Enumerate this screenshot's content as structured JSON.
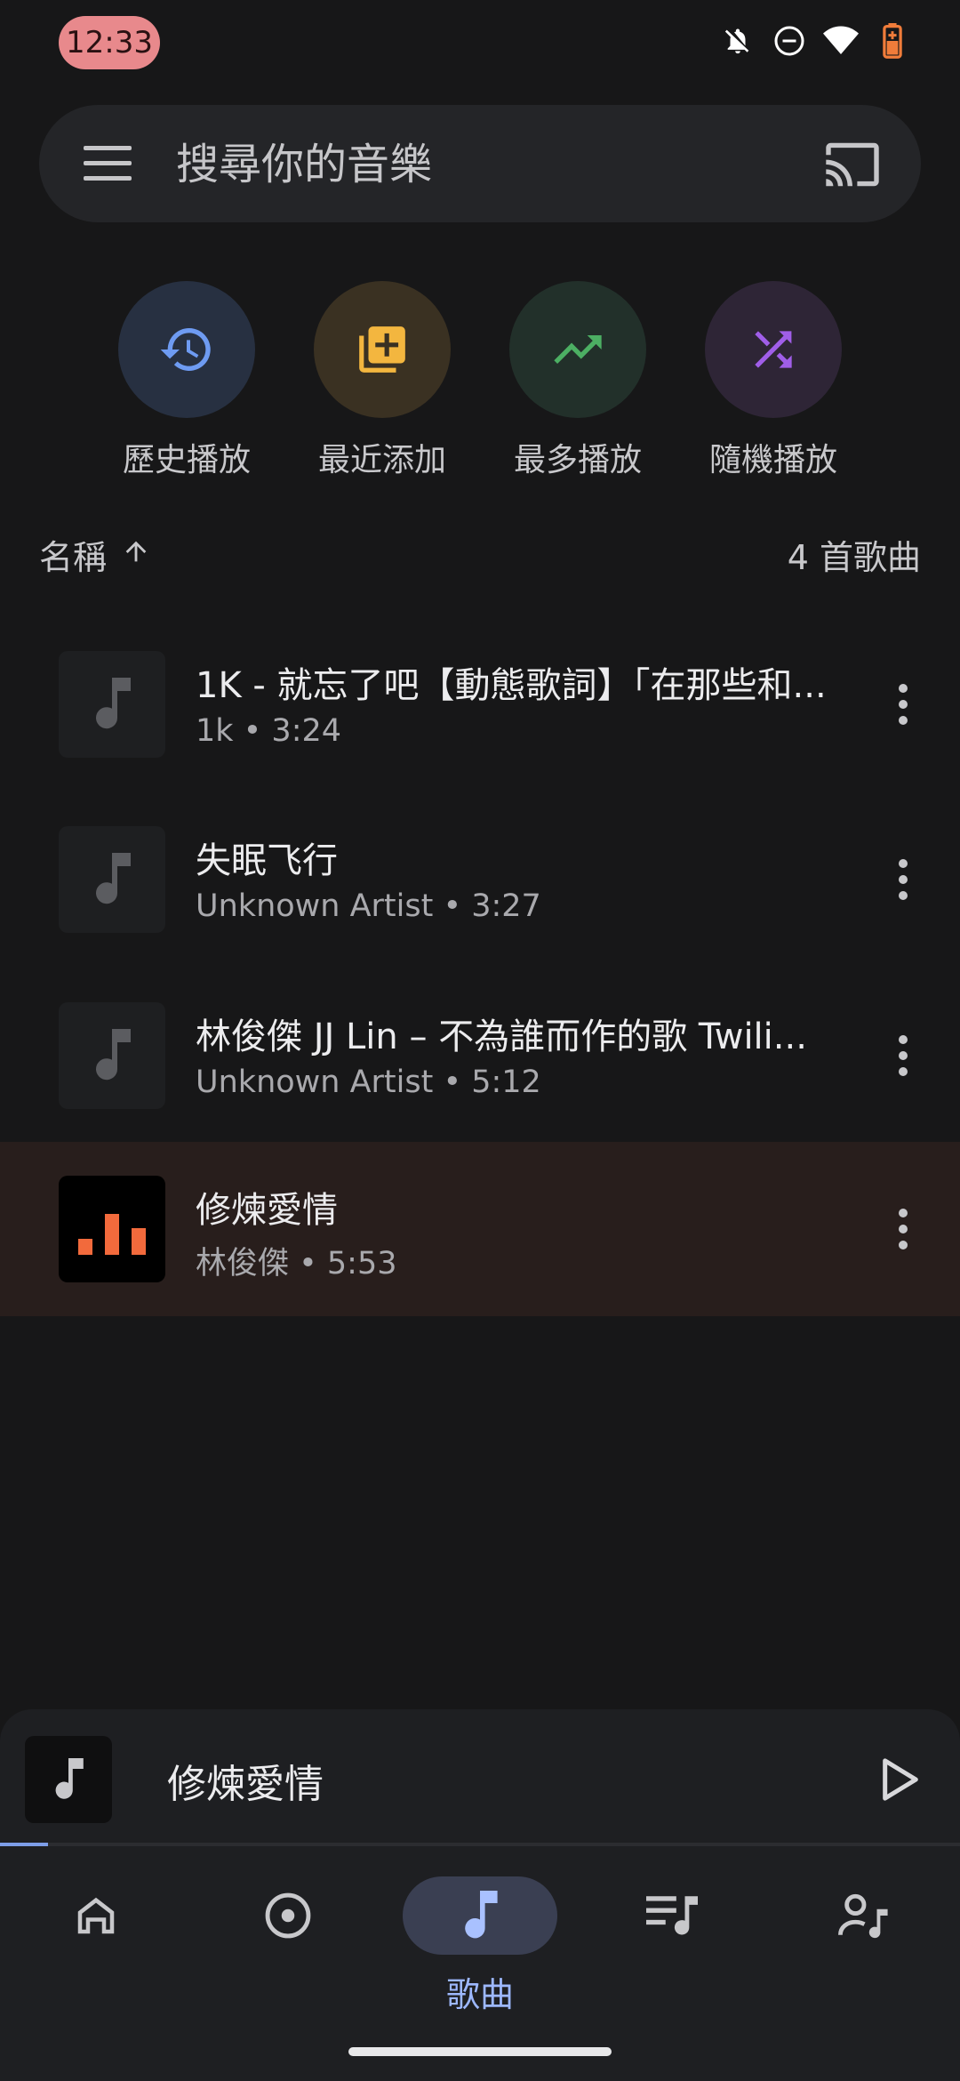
{
  "status_bar": {
    "time": "12:33",
    "icons": [
      "bell-off-icon",
      "do-not-disturb-icon",
      "wifi-icon",
      "battery-charging-icon"
    ]
  },
  "search": {
    "placeholder": "搜尋你的音樂",
    "value": ""
  },
  "quick_actions": [
    {
      "label": "歷史播放",
      "icon": "history-icon",
      "bg": "#273041",
      "fg": "#6e9bf2"
    },
    {
      "label": "最近添加",
      "icon": "add-library-icon",
      "bg": "#3a3122",
      "fg": "#f3b63f"
    },
    {
      "label": "最多播放",
      "icon": "trending-up-icon",
      "bg": "#22302a",
      "fg": "#4caf63"
    },
    {
      "label": "隨機播放",
      "icon": "shuffle-icon",
      "bg": "#2e2536",
      "fg": "#a05ee8"
    }
  ],
  "list_header": {
    "sort_label": "名稱",
    "sort_icon": "arrow-up-icon",
    "count": "4 首歌曲"
  },
  "songs": [
    {
      "title": "1K - 就忘了吧【動態歌詞】「在那些和...",
      "subtitle": "1k • 3:24",
      "active": false
    },
    {
      "title": "失眠飞行",
      "subtitle": "Unknown Artist • 3:27",
      "active": false
    },
    {
      "title": "林俊傑 JJ Lin – 不為誰而作的歌 Twili...",
      "subtitle": "Unknown Artist • 5:12",
      "active": false
    },
    {
      "title": "修煉愛情",
      "subtitle": "林俊傑 • 5:53",
      "active": true
    }
  ],
  "mini_player": {
    "title": "修煉愛情",
    "progress": 0.05
  },
  "bottom_nav": {
    "items": [
      {
        "icon": "home-icon",
        "label": ""
      },
      {
        "icon": "album-icon",
        "label": ""
      },
      {
        "icon": "music-note-icon",
        "label": "歌曲",
        "selected": true
      },
      {
        "icon": "playlist-icon",
        "label": ""
      },
      {
        "icon": "artist-icon",
        "label": ""
      }
    ]
  },
  "colors": {
    "accent": "#9db8ff",
    "now_playing_bars": "#f26a3c"
  }
}
